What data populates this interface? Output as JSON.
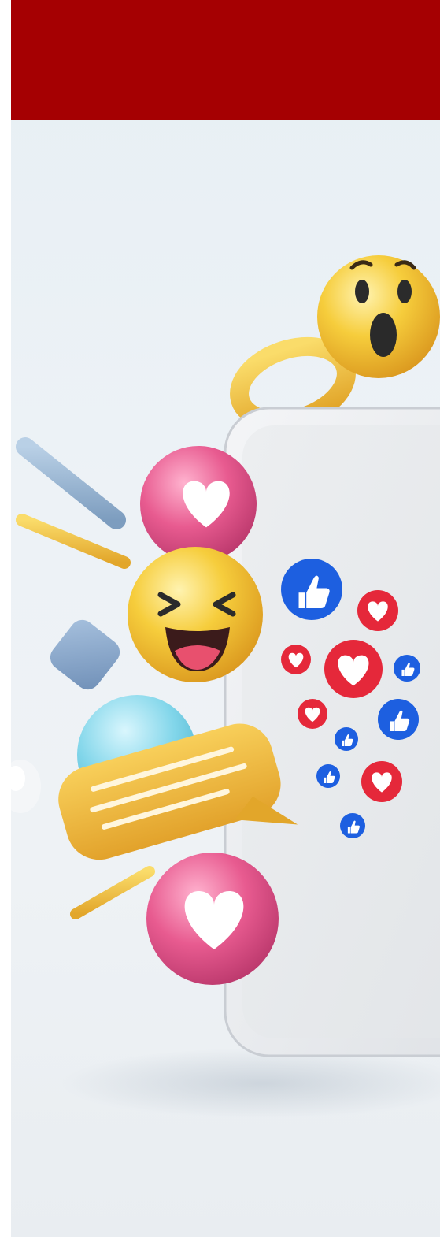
{
  "header": {
    "color": "#a50002"
  },
  "image": {
    "subject": "3d-social-media-reactions-phone",
    "palette": {
      "background": "#e9f0f5",
      "phone_body": "#eceef1",
      "like_blue": "#1d5fe0",
      "heart_red": "#e5283a",
      "pink_bubble": "#e45a8f",
      "emoji_yellow": "#f2c038",
      "chat_bubble": "#f0b93a",
      "rod_blue": "#8fb0cf",
      "cube_blue": "#7f9fc4",
      "teal_bubble": "#7fd3e6"
    },
    "icons": [
      "wow-emoji-icon",
      "laugh-emoji-icon",
      "like-icon",
      "heart-icon",
      "chat-bubble-icon"
    ]
  }
}
